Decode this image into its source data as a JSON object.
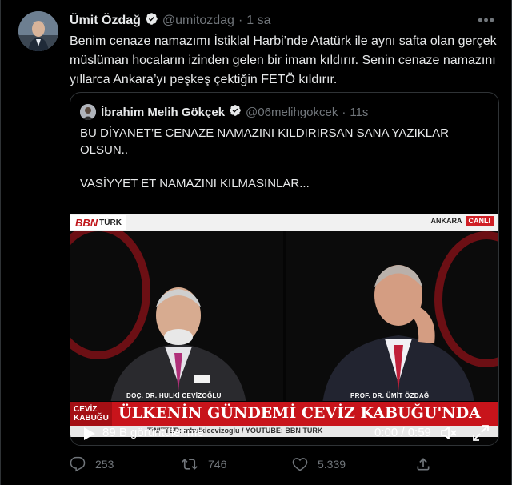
{
  "tweet": {
    "author_name": "Ümit Özdağ",
    "handle": "@umitozdag",
    "separator": "·",
    "time": "1 sa",
    "more_icon": "more-horizontal-icon",
    "text": "Benim cenaze namazımı İstiklal Harbi’nde Atatürk ile aynı safta olan gerçek müslüman hocaların izinden gelen bir imam kıldırır. Senin cenaze namazını yıllarca Ankara’yı peşkeş çektiğin FETÖ kıldırır."
  },
  "quote": {
    "author_name": "İbrahim Melih Gökçek",
    "handle": "@06melihgokcek",
    "separator": "·",
    "time": "11s",
    "line1": "BU DİYANET’E CENAZE NAMAZINI KILDIRIRSAN SANA YAZIKLAR OLSUN..",
    "line2": "VASİYYET ET NAMAZINI KILMASINLAR..."
  },
  "video": {
    "channel": "BBN",
    "channel_suffix": "TÜRK",
    "location": "ANKARA",
    "live": "CANLI",
    "left_caption": "DOÇ. DR. HULKİ CEVİZOĞLU",
    "right_caption": "PROF. DR. ÜMİT ÖZDAĞ",
    "program_box": "CEVİZ KABUĞU",
    "headline": "ÜLKENİN GÜNDEMİ CEVİZ KABUĞU'NDA",
    "ticker": "TWITTER: mhulkicevizoglu / YOUTUBE: BBN TURK",
    "views": "89 B görüntülenme",
    "time_display": "0:00 / 0:59"
  },
  "actions": {
    "reply_count": "253",
    "retweet_count": "746",
    "like_count": "5.339"
  },
  "colors": {
    "background": "#000000",
    "text": "#e7e9ea",
    "muted": "#71767b",
    "border": "#2f3336",
    "verified": "#e7e9ea",
    "bbn_red": "#c8141b"
  }
}
